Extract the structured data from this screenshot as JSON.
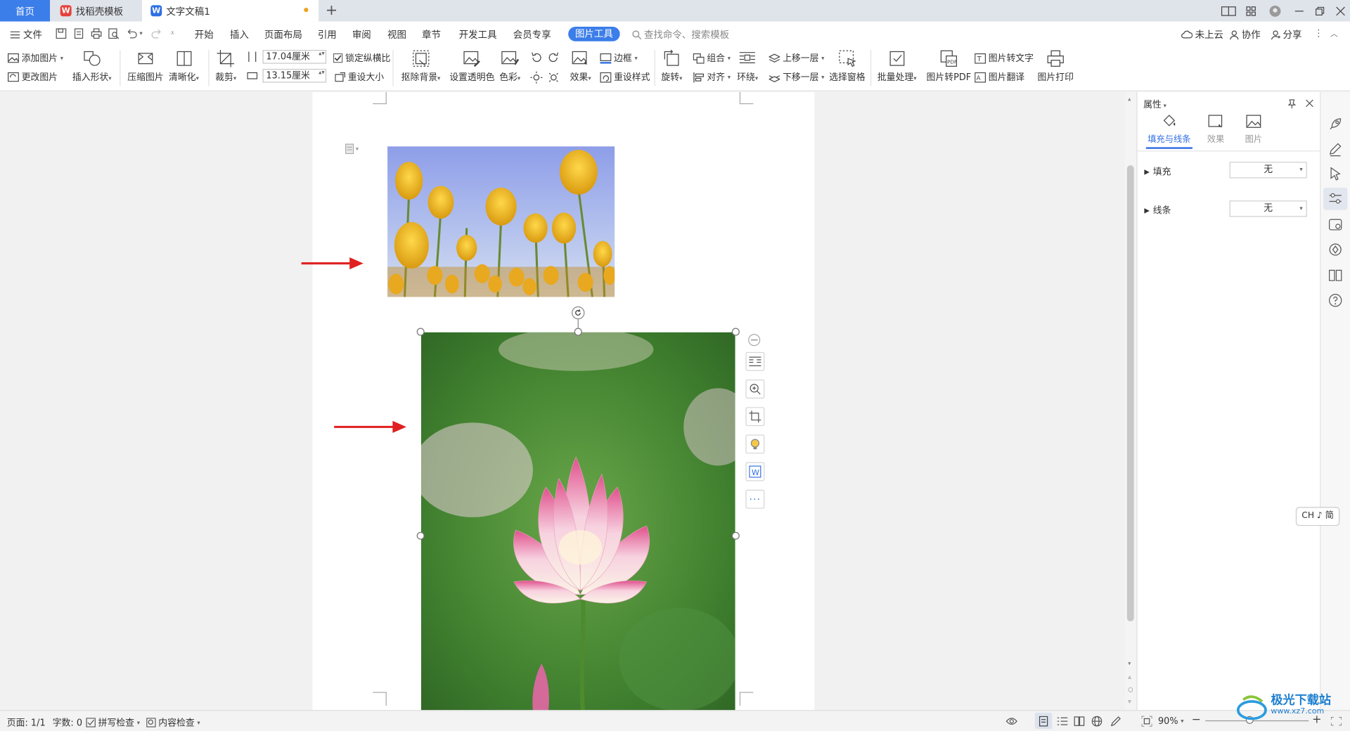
{
  "titlebar": {
    "tabs": [
      {
        "label": "首页"
      },
      {
        "label": "找稻壳模板"
      },
      {
        "label": "文字文稿1"
      }
    ],
    "add_tab": "+"
  },
  "menubar": {
    "file": "文件",
    "items": [
      "开始",
      "插入",
      "页面布局",
      "引用",
      "审阅",
      "视图",
      "章节",
      "开发工具",
      "会员专享"
    ],
    "active": "图片工具",
    "search_placeholder": "查找命令、搜索模板",
    "cloud": "未上云",
    "collab": "协作",
    "share": "分享"
  },
  "ribbon": {
    "add_picture": "添加图片",
    "change_picture": "更改图片",
    "insert_shape": "插入形状",
    "compress": "压缩图片",
    "sharpen": "清晰化",
    "crop": "裁剪",
    "width_value": "17.04厘米",
    "height_value": "13.15厘米",
    "lock_ratio": "锁定纵横比",
    "reset_size": "重设大小",
    "remove_bg": "抠除背景",
    "set_transparent": "设置透明色",
    "color": "色彩",
    "effects": "效果",
    "border": "边框",
    "reset_style": "重设样式",
    "rotate": "旋转",
    "group": "组合",
    "align": "对齐",
    "wrap": "环绕",
    "bring_forward": "上移一层",
    "send_backward": "下移一层",
    "selection_pane": "选择窗格",
    "batch": "批量处理",
    "to_pdf": "图片转PDF",
    "to_text": "图片转文字",
    "translate": "图片翻译",
    "print": "图片打印"
  },
  "panel": {
    "title": "属性",
    "tabs": [
      "填充与线条",
      "效果",
      "图片"
    ],
    "fill_label": "填充",
    "fill_value": "无",
    "line_label": "线条",
    "line_value": "无"
  },
  "ime": {
    "label": "CH ♪ 简"
  },
  "statusbar": {
    "page": "页面: 1/1",
    "words": "字数: 0",
    "spell": "拼写检查",
    "content": "内容检查",
    "zoom": "90%"
  },
  "watermark": {
    "text": "极光下载站",
    "url": "www.xz7.com"
  },
  "colors": {
    "accent": "#3b7de9",
    "arrow": "#e02020"
  }
}
